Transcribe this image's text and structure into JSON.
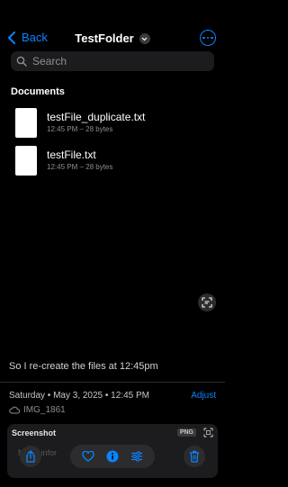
{
  "nav": {
    "back_label": "Back",
    "title": "TestFolder"
  },
  "search": {
    "placeholder": "Search"
  },
  "section_title": "Documents",
  "files": [
    {
      "name": "testFile_duplicate.txt",
      "meta": "12:45 PM – 28 bytes"
    },
    {
      "name": "testFile.txt",
      "meta": "12:45 PM – 28 bytes"
    }
  ],
  "photo_info": {
    "caption": "So I re-create the files at 12:45pm",
    "date": "Saturday • May 3, 2025 • 12:45 PM",
    "adjust_label": "Adjust",
    "image_name": "IMG_1861",
    "panel_title": "Screenshot",
    "format_badge": "PNG",
    "faded_text": "No … infor"
  },
  "colors": {
    "accent": "#0a84ff",
    "background": "#000000",
    "panel": "#1c1c1e"
  }
}
